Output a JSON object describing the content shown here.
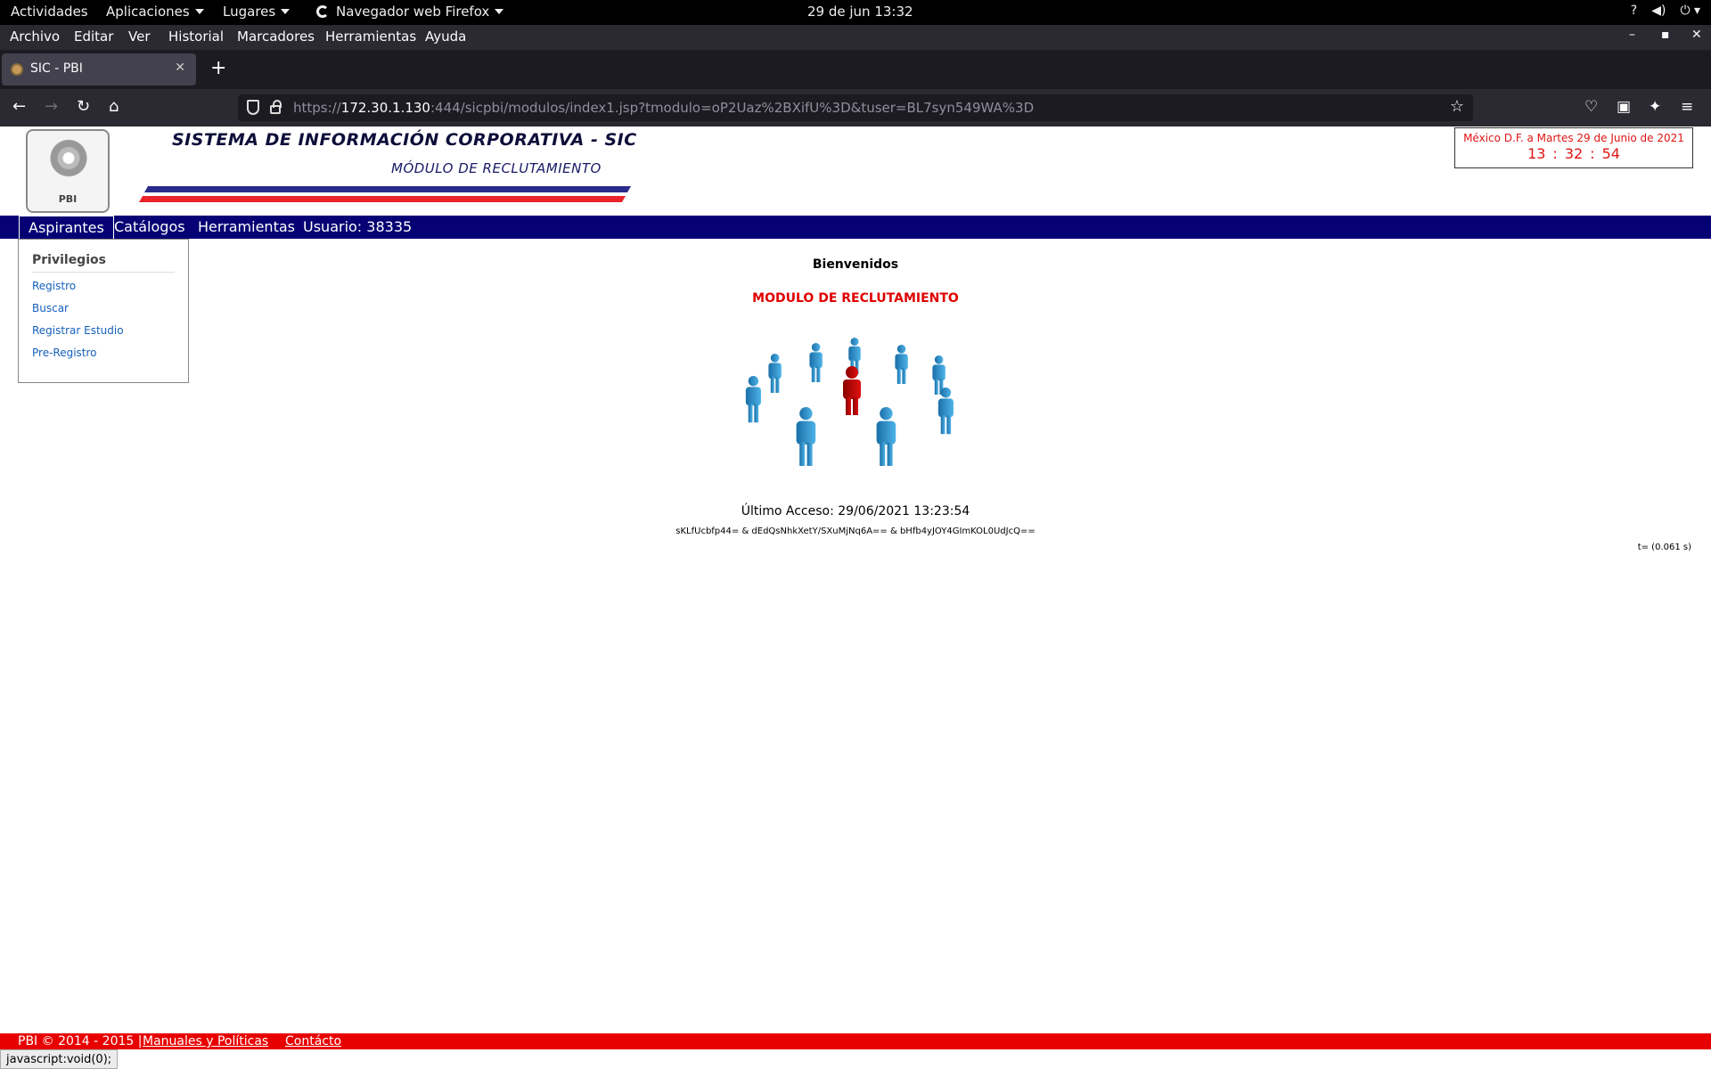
{
  "system_bar": {
    "activities": "Actividades",
    "applications": "Aplicaciones",
    "places": "Lugares",
    "app_name": "Navegador web Firefox",
    "clock": "29 de jun  13:32"
  },
  "menu": {
    "items": [
      "Archivo",
      "Editar",
      "Ver",
      "Historial",
      "Marcadores",
      "Herramientas",
      "Ayuda"
    ]
  },
  "tab": {
    "title": "SIC - PBI",
    "close": "✕",
    "new_tab": "+"
  },
  "address_bar": {
    "scheme": "https://",
    "host": "172.30.1.130",
    "rest": ":444/sicpbi/modulos/index1.jsp?tmodulo=oP2Uaz%2BXifU%3D&tuser=BL7syn549WA%3D"
  },
  "header": {
    "logo_text": "PBI",
    "title": "SISTEMA DE INFORMACIÓN CORPORATIVA - SIC",
    "subtitle": "MÓDULO DE RECLUTAMIENTO",
    "date_line": "México D.F. a Martes 29 de Junio de 2021",
    "clock": {
      "hh": "13",
      "mm": "32",
      "ss": "54",
      "sep": ":"
    }
  },
  "nav": {
    "aspirantes": "Aspirantes",
    "catalogos": "Catálogos",
    "herramientas": "Herramientas",
    "usuario": "Usuario: 38335"
  },
  "dropdown": {
    "heading": "Privilegios",
    "items": [
      "Registro",
      "Buscar",
      "Registrar Estudio",
      "Pre-Registro"
    ]
  },
  "main": {
    "welcome": "Bienvenidos",
    "module": "MODULO DE RECLUTAMIENTO",
    "last_access": "Último Acceso: 29/06/2021 13:23:54",
    "tokens": "sKLfUcbfp44= & dEdQsNhkXetY/SXuMjNq6A== & bHfb4yJOY4GImKOL0UdJcQ==",
    "timer": "t= (0.061 s)"
  },
  "footer": {
    "copyright": "PBI © 2014 - 2015 |",
    "manuals": "Manuales y Políticas",
    "contact": "Contácto"
  },
  "status_bar": "javascript:void(0);",
  "colors": {
    "nav_bg": "#050073",
    "footer_bg": "#e80000",
    "accent_red": "#e00000",
    "link_blue": "#1560bd"
  }
}
